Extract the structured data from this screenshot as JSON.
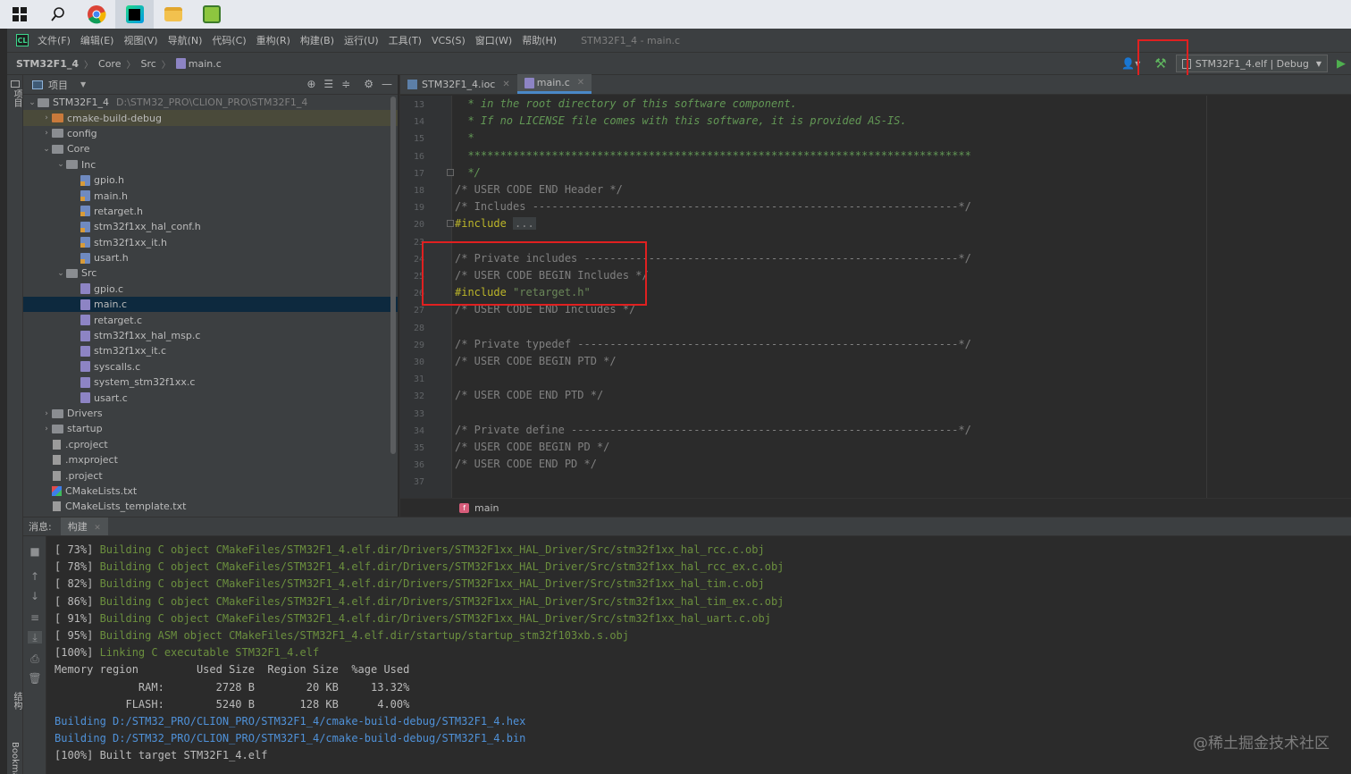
{
  "taskbar": {
    "apps": [
      "windows-start",
      "search",
      "chrome",
      "clion",
      "file-explorer",
      "notepad"
    ]
  },
  "menubar": {
    "items": [
      "文件(F)",
      "编辑(E)",
      "视图(V)",
      "导航(N)",
      "代码(C)",
      "重构(R)",
      "构建(B)",
      "运行(U)",
      "工具(T)",
      "VCS(S)",
      "窗口(W)",
      "帮助(H)"
    ],
    "title": "STM32F1_4 - main.c"
  },
  "navbar": {
    "project": "STM32F1_4",
    "crumb1": "Core",
    "crumb2": "Src",
    "file": "main.c",
    "run_config": "STM32F1_4.elf | Debug"
  },
  "leftstrip": {
    "project_label": "项目",
    "structure_label": "结构",
    "bookmarks_label": "Bookmarks"
  },
  "project_panel": {
    "title": "项目",
    "root_name": "STM32F1_4",
    "root_path": "D:\\STM32_PRO\\CLION_PRO\\STM32F1_4",
    "items": [
      {
        "label": "cmake-build-debug",
        "depth": 1,
        "type": "folder-orange",
        "arrow": "›"
      },
      {
        "label": "config",
        "depth": 1,
        "type": "folder",
        "arrow": "›"
      },
      {
        "label": "Core",
        "depth": 1,
        "type": "folder",
        "arrow": "⌄"
      },
      {
        "label": "Inc",
        "depth": 2,
        "type": "folder",
        "arrow": "⌄"
      },
      {
        "label": "gpio.h",
        "depth": 3,
        "type": "h"
      },
      {
        "label": "main.h",
        "depth": 3,
        "type": "h"
      },
      {
        "label": "retarget.h",
        "depth": 3,
        "type": "h"
      },
      {
        "label": "stm32f1xx_hal_conf.h",
        "depth": 3,
        "type": "h"
      },
      {
        "label": "stm32f1xx_it.h",
        "depth": 3,
        "type": "h"
      },
      {
        "label": "usart.h",
        "depth": 3,
        "type": "h"
      },
      {
        "label": "Src",
        "depth": 2,
        "type": "folder",
        "arrow": "⌄"
      },
      {
        "label": "gpio.c",
        "depth": 3,
        "type": "c"
      },
      {
        "label": "main.c",
        "depth": 3,
        "type": "c"
      },
      {
        "label": "retarget.c",
        "depth": 3,
        "type": "c"
      },
      {
        "label": "stm32f1xx_hal_msp.c",
        "depth": 3,
        "type": "c"
      },
      {
        "label": "stm32f1xx_it.c",
        "depth": 3,
        "type": "c"
      },
      {
        "label": "syscalls.c",
        "depth": 3,
        "type": "c"
      },
      {
        "label": "system_stm32f1xx.c",
        "depth": 3,
        "type": "c"
      },
      {
        "label": "usart.c",
        "depth": 3,
        "type": "c"
      },
      {
        "label": "Drivers",
        "depth": 1,
        "type": "folder",
        "arrow": "›"
      },
      {
        "label": "startup",
        "depth": 1,
        "type": "folder",
        "arrow": "›"
      },
      {
        "label": ".cproject",
        "depth": 1,
        "type": "doc"
      },
      {
        "label": ".mxproject",
        "depth": 1,
        "type": "doc"
      },
      {
        "label": ".project",
        "depth": 1,
        "type": "doc"
      },
      {
        "label": "CMakeLists.txt",
        "depth": 1,
        "type": "cmake"
      },
      {
        "label": "CMakeLists_template.txt",
        "depth": 1,
        "type": "doc"
      }
    ]
  },
  "editor": {
    "tabs": [
      {
        "label": "STM32F1_4.ioc",
        "active": false
      },
      {
        "label": "main.c",
        "active": true
      }
    ],
    "lines": [
      {
        "n": "13",
        "parts": [
          [
            "  * in the root directory of this software component.",
            "doc"
          ]
        ]
      },
      {
        "n": "14",
        "parts": [
          [
            "  * If no LICENSE file comes with this software, it is provided AS-IS.",
            "doc"
          ]
        ]
      },
      {
        "n": "15",
        "parts": [
          [
            "  *",
            "doc"
          ]
        ]
      },
      {
        "n": "16",
        "parts": [
          [
            "  ******************************************************************************",
            "doc"
          ]
        ]
      },
      {
        "n": "17",
        "parts": [
          [
            "  */",
            "doc"
          ]
        ]
      },
      {
        "n": "18",
        "parts": [
          [
            "/* USER CODE END Header */",
            "com"
          ]
        ]
      },
      {
        "n": "19",
        "parts": [
          [
            "/* Includes ------------------------------------------------------------------*/",
            "com"
          ]
        ]
      },
      {
        "n": "20",
        "parts": [
          [
            "#include",
            "kw"
          ],
          [
            " ",
            "com"
          ],
          [
            "...",
            "fold"
          ]
        ]
      },
      {
        "n": "23",
        "parts": []
      },
      {
        "n": "24",
        "parts": [
          [
            "/* Private includes ----------------------------------------------------------*/",
            "com"
          ]
        ]
      },
      {
        "n": "25",
        "parts": [
          [
            "/* USER CODE BEGIN Includes */",
            "com"
          ]
        ]
      },
      {
        "n": "26",
        "parts": [
          [
            "#include",
            "kw"
          ],
          [
            " \"retarget.h\"",
            "str"
          ]
        ]
      },
      {
        "n": "27",
        "parts": [
          [
            "/* USER CODE END Includes */",
            "com"
          ]
        ]
      },
      {
        "n": "28",
        "parts": []
      },
      {
        "n": "29",
        "parts": [
          [
            "/* Private typedef -----------------------------------------------------------*/",
            "com"
          ]
        ]
      },
      {
        "n": "30",
        "parts": [
          [
            "/* USER CODE BEGIN PTD */",
            "com"
          ]
        ]
      },
      {
        "n": "31",
        "parts": []
      },
      {
        "n": "32",
        "parts": [
          [
            "/* USER CODE END PTD */",
            "com"
          ]
        ]
      },
      {
        "n": "33",
        "parts": []
      },
      {
        "n": "34",
        "parts": [
          [
            "/* Private define ------------------------------------------------------------*/",
            "com"
          ]
        ]
      },
      {
        "n": "35",
        "parts": [
          [
            "/* USER CODE BEGIN PD */",
            "com"
          ]
        ]
      },
      {
        "n": "36",
        "parts": [
          [
            "/* USER CODE END PD */",
            "com"
          ]
        ]
      },
      {
        "n": "37",
        "parts": []
      }
    ],
    "breadcrumb": "main",
    "breadcrumb_icon": "f"
  },
  "bottom": {
    "messages_label": "消息:",
    "tab_label": "构建",
    "output": [
      [
        [
          "[ 73%] ",
          "norm"
        ],
        [
          "Building C object CMakeFiles/STM32F1_4.elf.dir/Drivers/STM32F1xx_HAL_Driver/Src/stm32f1xx_hal_rcc.c.obj",
          "green"
        ]
      ],
      [
        [
          "[ 78%] ",
          "norm"
        ],
        [
          "Building C object CMakeFiles/STM32F1_4.elf.dir/Drivers/STM32F1xx_HAL_Driver/Src/stm32f1xx_hal_rcc_ex.c.obj",
          "green"
        ]
      ],
      [
        [
          "[ 82%] ",
          "norm"
        ],
        [
          "Building C object CMakeFiles/STM32F1_4.elf.dir/Drivers/STM32F1xx_HAL_Driver/Src/stm32f1xx_hal_tim.c.obj",
          "green"
        ]
      ],
      [
        [
          "[ 86%] ",
          "norm"
        ],
        [
          "Building C object CMakeFiles/STM32F1_4.elf.dir/Drivers/STM32F1xx_HAL_Driver/Src/stm32f1xx_hal_tim_ex.c.obj",
          "green"
        ]
      ],
      [
        [
          "[ 91%] ",
          "norm"
        ],
        [
          "Building C object CMakeFiles/STM32F1_4.elf.dir/Drivers/STM32F1xx_HAL_Driver/Src/stm32f1xx_hal_uart.c.obj",
          "green"
        ]
      ],
      [
        [
          "[ 95%] ",
          "norm"
        ],
        [
          "Building ASM object CMakeFiles/STM32F1_4.elf.dir/startup/startup_stm32f103xb.s.obj",
          "green"
        ]
      ],
      [
        [
          "[100%] ",
          "norm"
        ],
        [
          "Linking C executable STM32F1_4.elf",
          "green"
        ]
      ],
      [
        [
          "Memory region         Used Size  Region Size  %age Used",
          "norm"
        ]
      ],
      [
        [
          "             RAM:        2728 B        20 KB     13.32%",
          "norm"
        ]
      ],
      [
        [
          "           FLASH:        5240 B       128 KB      4.00%",
          "norm"
        ]
      ],
      [
        [
          "Building D:/STM32_PRO/CLION_PRO/STM32F1_4/cmake-build-debug/STM32F1_4.hex",
          "link"
        ]
      ],
      [
        [
          "Building D:/STM32_PRO/CLION_PRO/STM32F1_4/cmake-build-debug/STM32F1_4.bin",
          "link"
        ]
      ],
      [
        [
          "[100%] Built target STM32F1_4.elf",
          "norm"
        ]
      ]
    ]
  },
  "watermark": "@稀土掘金技术社区"
}
